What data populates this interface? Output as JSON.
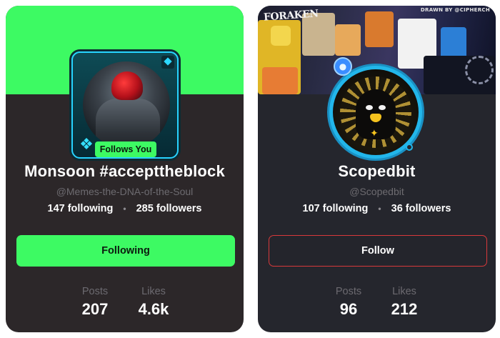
{
  "cards": [
    {
      "name": "Monsoon #accepttheblock",
      "handle": "@Memes-the-DNA-of-the-Soul",
      "following_count": "147 following",
      "followers_count": "285 followers",
      "follows_you_badge": "Follows You",
      "button_label": "Following",
      "stats": [
        {
          "label": "Posts",
          "value": "207"
        },
        {
          "label": "Likes",
          "value": "4.6k"
        }
      ],
      "accent_color": "#3dfa63"
    },
    {
      "name": "Scopedbit",
      "handle": "@Scopedbit",
      "following_count": "107 following",
      "followers_count": "36 followers",
      "banner_credit": "DRAWN BY @CIPHERCH",
      "banner_graffiti": "FORAKEN",
      "button_label": "Follow",
      "stats": [
        {
          "label": "Posts",
          "value": "96"
        },
        {
          "label": "Likes",
          "value": "212"
        }
      ],
      "accent_color": "#d8393b"
    }
  ],
  "separator": "•"
}
